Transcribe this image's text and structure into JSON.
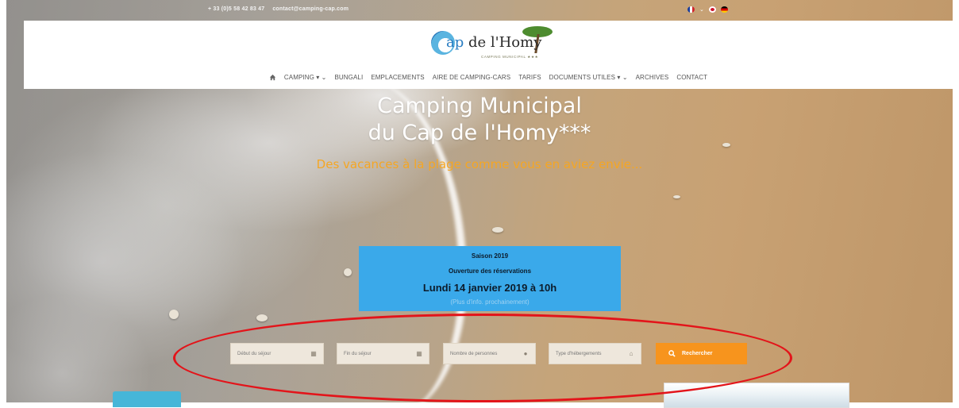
{
  "topbar": {
    "phone": "+ 33 (0)5 58 42 83 47",
    "email": "contact@camping-cap.com",
    "languages": [
      "fr",
      "en",
      "de"
    ]
  },
  "logo": {
    "name_prefix": "ap",
    "name_rest": " de l'Homy",
    "subtitle": "CAMPING MUNICIPAL ★★★"
  },
  "nav": {
    "items": [
      {
        "label": "CAMPING ▾ ⌄"
      },
      {
        "label": "BUNGALI"
      },
      {
        "label": "EMPLACEMENTS"
      },
      {
        "label": "AIRE DE CAMPING-CARS"
      },
      {
        "label": "TARIFS"
      },
      {
        "label": "DOCUMENTS UTILES ▾ ⌄"
      },
      {
        "label": "ARCHIVES"
      },
      {
        "label": "CONTACT"
      }
    ]
  },
  "hero": {
    "title_line1": "Camping Municipal",
    "title_line2": "du Cap de l'Homy***",
    "tagline": "Des vacances à la plage comme vous en aviez envie..."
  },
  "announcement": {
    "season": "Saison 2019",
    "subtitle": "Ouverture des réservations",
    "date": "Lundi 14 janvier 2019 à 10h",
    "note": "(Plus d'info. prochainement)",
    "color": "#3aa9ea"
  },
  "search": {
    "start_placeholder": "Début du séjour",
    "end_placeholder": "Fin du séjour",
    "people_placeholder": "Nombre de personnes",
    "type_placeholder": "Type d'hébergements",
    "button_label": "Rechercher",
    "button_color": "#f7941d"
  },
  "colors": {
    "accent_orange": "#f5a623",
    "annotation_red": "#e3141a"
  }
}
